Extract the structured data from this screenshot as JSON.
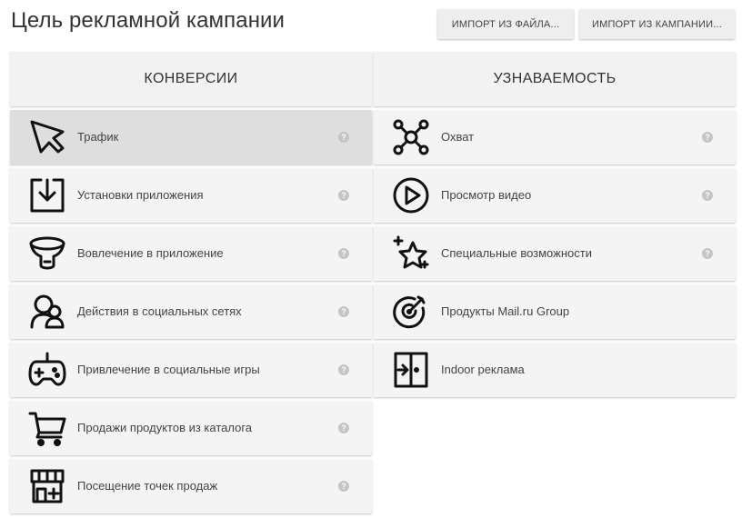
{
  "header": {
    "title": "Цель рекламной кампании",
    "import_file_label": "ИМПОРТ ИЗ ФАЙЛА...",
    "import_campaign_label": "ИМПОРТ ИЗ КАМПАНИИ..."
  },
  "left": {
    "title": "КОНВЕРСИИ",
    "items": [
      {
        "label": "Трафик",
        "icon": "cursor-icon",
        "selected": true
      },
      {
        "label": "Установки приложения",
        "icon": "download-box-icon"
      },
      {
        "label": "Вовлечение в приложение",
        "icon": "funnel-icon"
      },
      {
        "label": "Действия в социальных сетях",
        "icon": "users-icon"
      },
      {
        "label": "Привлечение в социальные игры",
        "icon": "gamepad-icon"
      },
      {
        "label": "Продажи продуктов из каталога",
        "icon": "cart-icon"
      },
      {
        "label": "Посещение точек продаж",
        "icon": "store-icon"
      }
    ]
  },
  "right": {
    "title": "УЗНАВАЕМОСТЬ",
    "items": [
      {
        "label": "Охват",
        "icon": "network-icon"
      },
      {
        "label": "Просмотр видео",
        "icon": "play-circle-icon"
      },
      {
        "label": "Специальные возможности",
        "icon": "star-sparkle-icon"
      },
      {
        "label": "Продукты Mail.ru Group",
        "icon": "target-icon"
      },
      {
        "label": "Indoor реклама",
        "icon": "door-enter-icon"
      }
    ]
  },
  "help_glyph": "?",
  "colors": {
    "selected_bg": "#dedede",
    "item_bg": "#f4f4f4",
    "help_bg": "#c4c4c4"
  }
}
